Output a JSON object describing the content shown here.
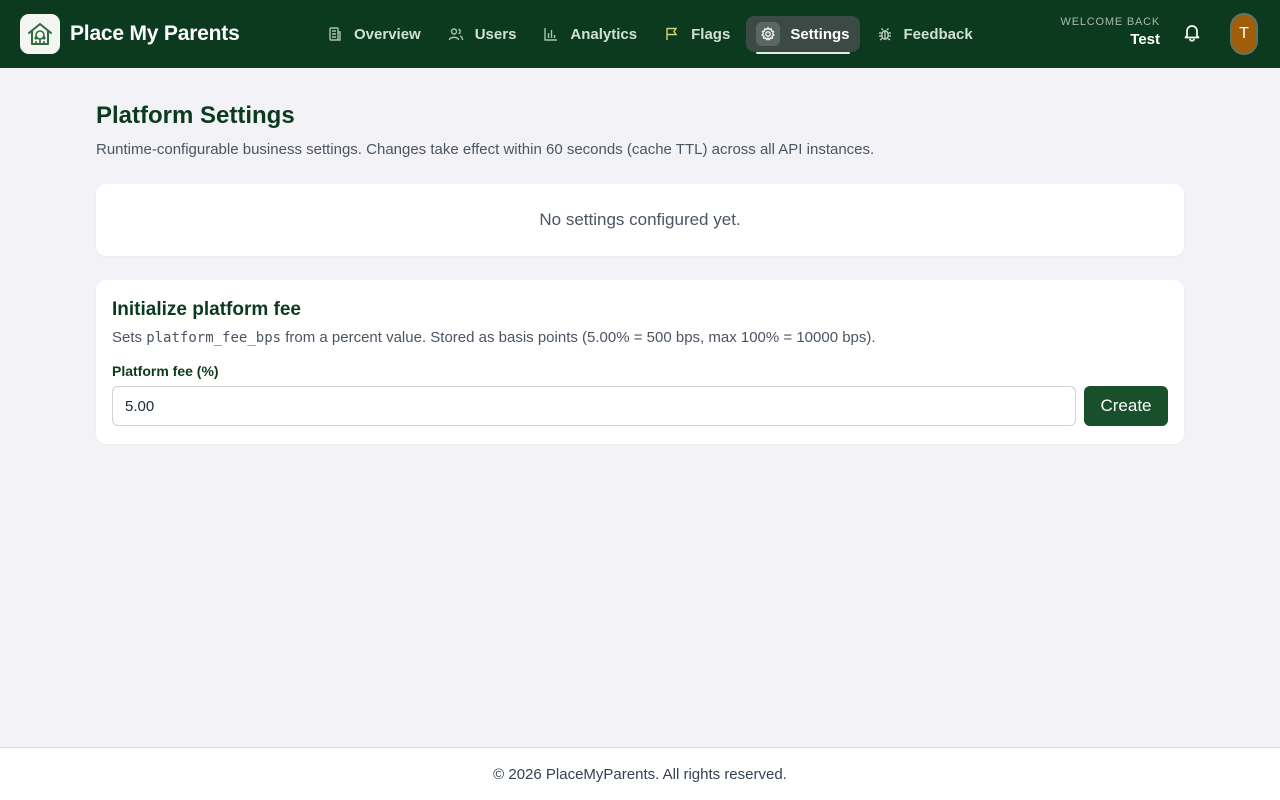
{
  "header": {
    "brand_name": "Place My Parents",
    "nav": [
      {
        "label": "Overview",
        "icon": "building-icon"
      },
      {
        "label": "Users",
        "icon": "users-icon"
      },
      {
        "label": "Analytics",
        "icon": "bar-chart-icon"
      },
      {
        "label": "Flags",
        "icon": "flag-icon"
      },
      {
        "label": "Settings",
        "icon": "gear-icon",
        "active": true
      },
      {
        "label": "Feedback",
        "icon": "bug-icon"
      }
    ],
    "welcome_label": "WELCOME BACK",
    "user_name": "Test",
    "avatar_initial": "T"
  },
  "main": {
    "title": "Platform Settings",
    "subtitle": "Runtime-configurable business settings. Changes take effect within 60 seconds (cache TTL) across all API instances.",
    "empty_message": "No settings configured yet.",
    "fee_card": {
      "title": "Initialize platform fee",
      "desc_prefix": "Sets ",
      "desc_code": "platform_fee_bps",
      "desc_suffix": " from a percent value. Stored as basis points (5.00% = 500 bps, max 100% = 10000 bps).",
      "label": "Platform fee (%)",
      "value": "5.00",
      "button": "Create"
    }
  },
  "footer": {
    "text": "© 2026 PlaceMyParents. All rights reserved."
  },
  "colors": {
    "header_bg": "#0c3a1f",
    "accent": "#17502b",
    "avatar_bg": "#a05d0a",
    "page_bg": "#f3f2f7"
  }
}
